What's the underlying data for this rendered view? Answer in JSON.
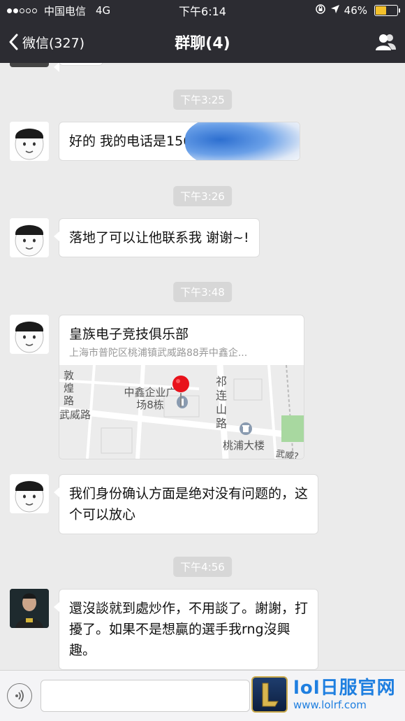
{
  "status": {
    "carrier": "中国电信",
    "network": "4G",
    "time": "下午6:14",
    "battery": "46%",
    "battery_level": 0.46
  },
  "nav": {
    "back_label": "微信(327)",
    "title": "群聊(4)"
  },
  "messages": [
    {
      "time": "下午3:25",
      "text": "好的 我的电话是156"
    },
    {
      "time": "下午3:26",
      "text": "落地了可以让他联系我 谢谢~!"
    },
    {
      "time": "下午3:48",
      "location": {
        "title": "皇族电子竞技俱乐部",
        "address": "上海市普陀区桃浦镇武威路88弄中鑫企...",
        "map_labels": {
          "dunhuang": "敦煌路",
          "wuwei": "武威路",
          "zhongxin": "中鑫企业广场8栋",
          "qilian": "祁连山路",
          "taopu": "桃浦大楼",
          "wuwei2": "武威?"
        }
      }
    },
    {
      "text": "我们身份确认方面是绝对没有问题的，这个可以放心"
    },
    {
      "time": "下午4:56",
      "text": "還沒談就到處炒作，不用談了。謝謝，打擾了。如果不是想贏的選手我rng沒興趣。"
    }
  ],
  "watermark": {
    "main": "lol日服官网",
    "url": "www.lolrf.com"
  }
}
